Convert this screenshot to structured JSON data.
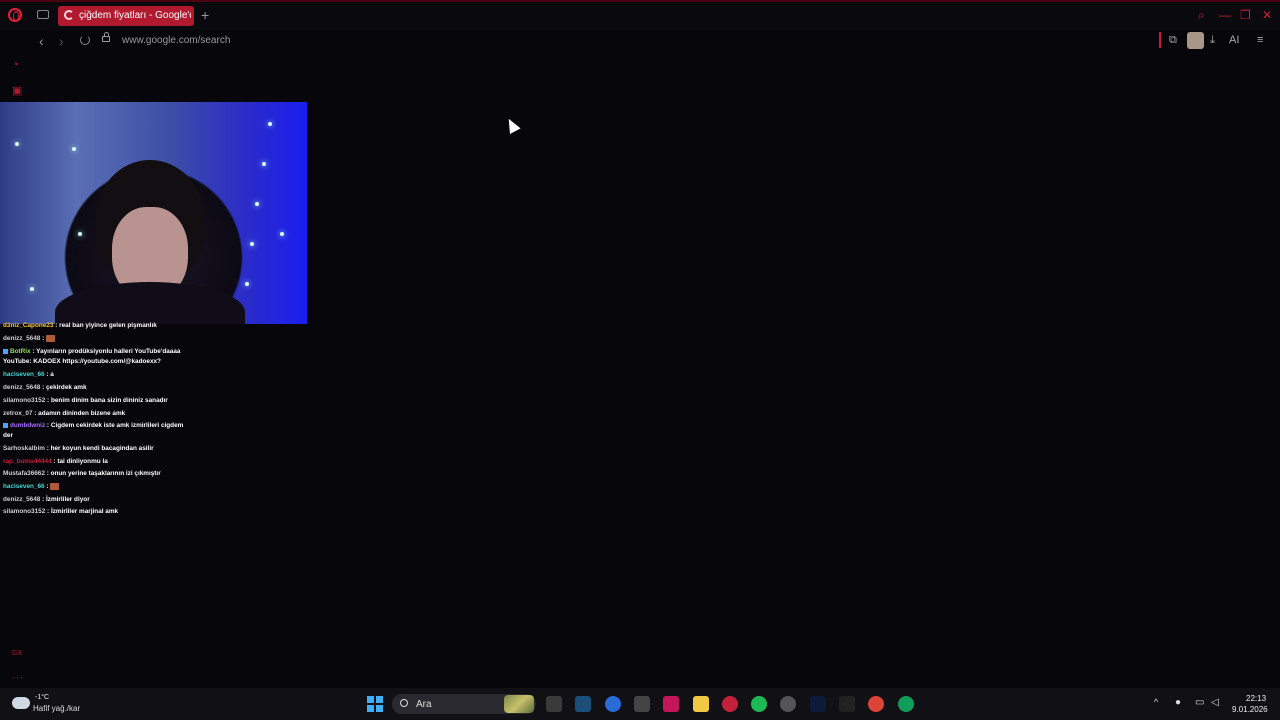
{
  "browser": {
    "tab": {
      "title": "çiğdem fiyatları - Google'da"
    },
    "new_tab_label": "+",
    "window_controls": {
      "search": "⌕",
      "minimize": "—",
      "restore": "❐",
      "close": "✕"
    },
    "nav": {
      "back": "‹",
      "forward": "›"
    },
    "url": "www.google.com/search",
    "extensions": {
      "puzzle": "⧉",
      "download": "⤓",
      "ai_label": "AI",
      "menu": "≡"
    }
  },
  "sidebar": {
    "items": [
      {
        "icon": "speed-dial-icon",
        "glyph": "◔"
      },
      {
        "icon": "twitch-icon",
        "glyph": "▣"
      },
      {
        "icon": "gx-icon",
        "glyph": "GX"
      },
      {
        "icon": "more-icon",
        "glyph": "···"
      }
    ]
  },
  "chat": {
    "messages": [
      {
        "user": "d3niz_Capone23",
        "color": "#f4c542",
        "text": " : real ban yiyince gelen pişmanlık"
      },
      {
        "user": "denizz_5648",
        "color": "#cfcfcf",
        "text": " : ",
        "emote": true
      },
      {
        "user": "BotRix",
        "color": "#8de05a",
        "text": " : Yayınların prodüksiyonlu halleri YouTube'daaaa",
        "badge": true
      },
      {
        "user": "",
        "color": "#ffffff",
        "text": "YouTube: KADOEX https://youtube.com/@kadoexx?"
      },
      {
        "user": "haciseven_66",
        "color": "#3fd9d0",
        "text": " : a"
      },
      {
        "user": "denizz_5648",
        "color": "#cfcfcf",
        "text": " : çekirdek amk"
      },
      {
        "user": "silamono3152",
        "color": "#cfcfcf",
        "text": " : benim dinim bana sizin dininiz sanadır"
      },
      {
        "user": "zetrox_07",
        "color": "#cfcfcf",
        "text": " : adamın dininden bizene amk"
      },
      {
        "user": "dumbdwniz",
        "color": "#a66cff",
        "text": " : Cigdem cekirdek iste amk izmirlileri cigdem",
        "badge": true
      },
      {
        "user": "",
        "color": "#ffffff",
        "text": "der"
      },
      {
        "user": "Sarhoskalbim",
        "color": "#cfcfcf",
        "text": " : her koyun kendi bacagindan asilir"
      },
      {
        "user": "rap_bumu44444",
        "color": "#d21a3c",
        "text": " : tai dinliyonmu la"
      },
      {
        "user": "Mustafa36662",
        "color": "#cfcfcf",
        "text": " : onun yerine taşaklarının izi çıkmıştır"
      },
      {
        "user": "haciseven_66",
        "color": "#3fd9d0",
        "text": " : ",
        "emote": true
      },
      {
        "user": "denizz_5648",
        "color": "#cfcfcf",
        "text": " : İzmirliler diyor"
      },
      {
        "user": "silamono3152",
        "color": "#cfcfcf",
        "text": " : İzmirliler marjinal amk"
      }
    ]
  },
  "taskbar": {
    "weather": {
      "temp": "-1°C",
      "desc": "Hafif yağ./kar"
    },
    "search_placeholder": "Ara",
    "apps": [
      {
        "name": "task-view",
        "color": "#3a3a3a"
      },
      {
        "name": "steam",
        "color": "#1b4f7a"
      },
      {
        "name": "cortana",
        "color": "#2a6bd8"
      },
      {
        "name": "unity",
        "color": "#444444"
      },
      {
        "name": "app-red",
        "color": "#c2185b"
      },
      {
        "name": "file-explorer",
        "color": "#f2c744"
      },
      {
        "name": "opera-gx",
        "color": "#c3203a"
      },
      {
        "name": "spotify",
        "color": "#1db954"
      },
      {
        "name": "app-circle",
        "color": "#555555"
      },
      {
        "name": "photoshop",
        "color": "#0e1a3a"
      },
      {
        "name": "capcut",
        "color": "#222222"
      },
      {
        "name": "chrome",
        "color": "#db4437"
      },
      {
        "name": "chrome-2",
        "color": "#0f9d58"
      }
    ],
    "clock": {
      "time": "22:13",
      "date": "9.01.2026"
    }
  }
}
